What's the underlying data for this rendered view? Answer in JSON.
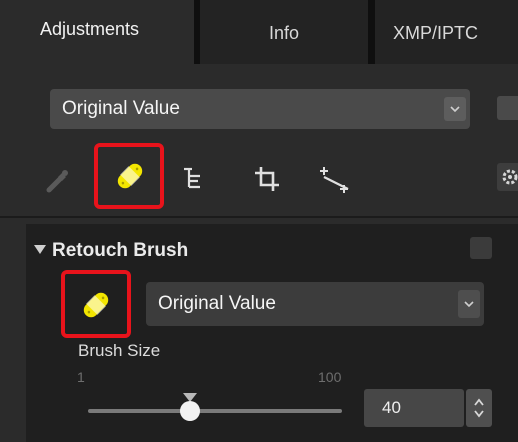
{
  "tabs": [
    {
      "label": "Adjustments",
      "active": true
    },
    {
      "label": "Info",
      "active": false
    },
    {
      "label": "XMP/IPTC",
      "active": false
    }
  ],
  "top_select": {
    "value": "Original Value"
  },
  "toolbar": {
    "icons": [
      "eyedropper-icon",
      "retouch-brush-icon",
      "hierarchy-icon",
      "crop-icon",
      "straighten-icon",
      "gear-icon"
    ],
    "highlighted": "retouch-brush-icon"
  },
  "panel": {
    "title": "Retouch Brush",
    "brush_select": {
      "value": "Original Value"
    },
    "brush_size": {
      "label": "Brush Size",
      "min_label": "1",
      "max_label": "100",
      "value": "40",
      "slider_fraction": 0.4
    }
  },
  "colors": {
    "highlight": "#e8131b",
    "brush_yellow": "#f3e600",
    "panel_bg": "#1f1f1f",
    "window_bg": "#2b2b2b"
  }
}
